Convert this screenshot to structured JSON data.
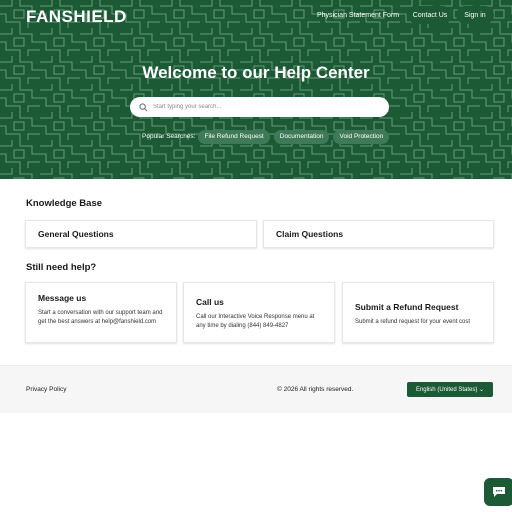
{
  "brand": {
    "logo_text": "FANSHIELD",
    "color": "#1b5a34"
  },
  "nav": {
    "physician_form": "Physician Statement Form",
    "contact": "Contact Us",
    "sign_in": "Sign in"
  },
  "hero": {
    "title": "Welcome to our Help Center",
    "search_placeholder": "Start typing your search...",
    "popular_label": "Popular Searches:",
    "popular_searches": [
      "File Refund Request",
      "Documentation",
      "Void Protection"
    ]
  },
  "knowledge_base": {
    "title": "Knowledge Base",
    "categories": [
      "General Questions",
      "Claim Questions"
    ]
  },
  "need_help": {
    "title": "Still need help?",
    "cards": [
      {
        "title": "Message us",
        "text": "Start a conversation with our support team and get the best answers at help@fanshield.com"
      },
      {
        "title": "Call us",
        "text": "Call our Interactive Voice Response menu at any time by dialing (844) 849-4827"
      },
      {
        "title": "Submit a Refund Request",
        "text": "Submit a refund request for your event cost"
      }
    ]
  },
  "footer": {
    "privacy": "Privacy Policy",
    "copyright": "© 2026 All rights reserved.",
    "language": "English (United States) ⌄"
  },
  "icons": {
    "search": "search-icon",
    "chat": "chat-bubble-icon"
  }
}
